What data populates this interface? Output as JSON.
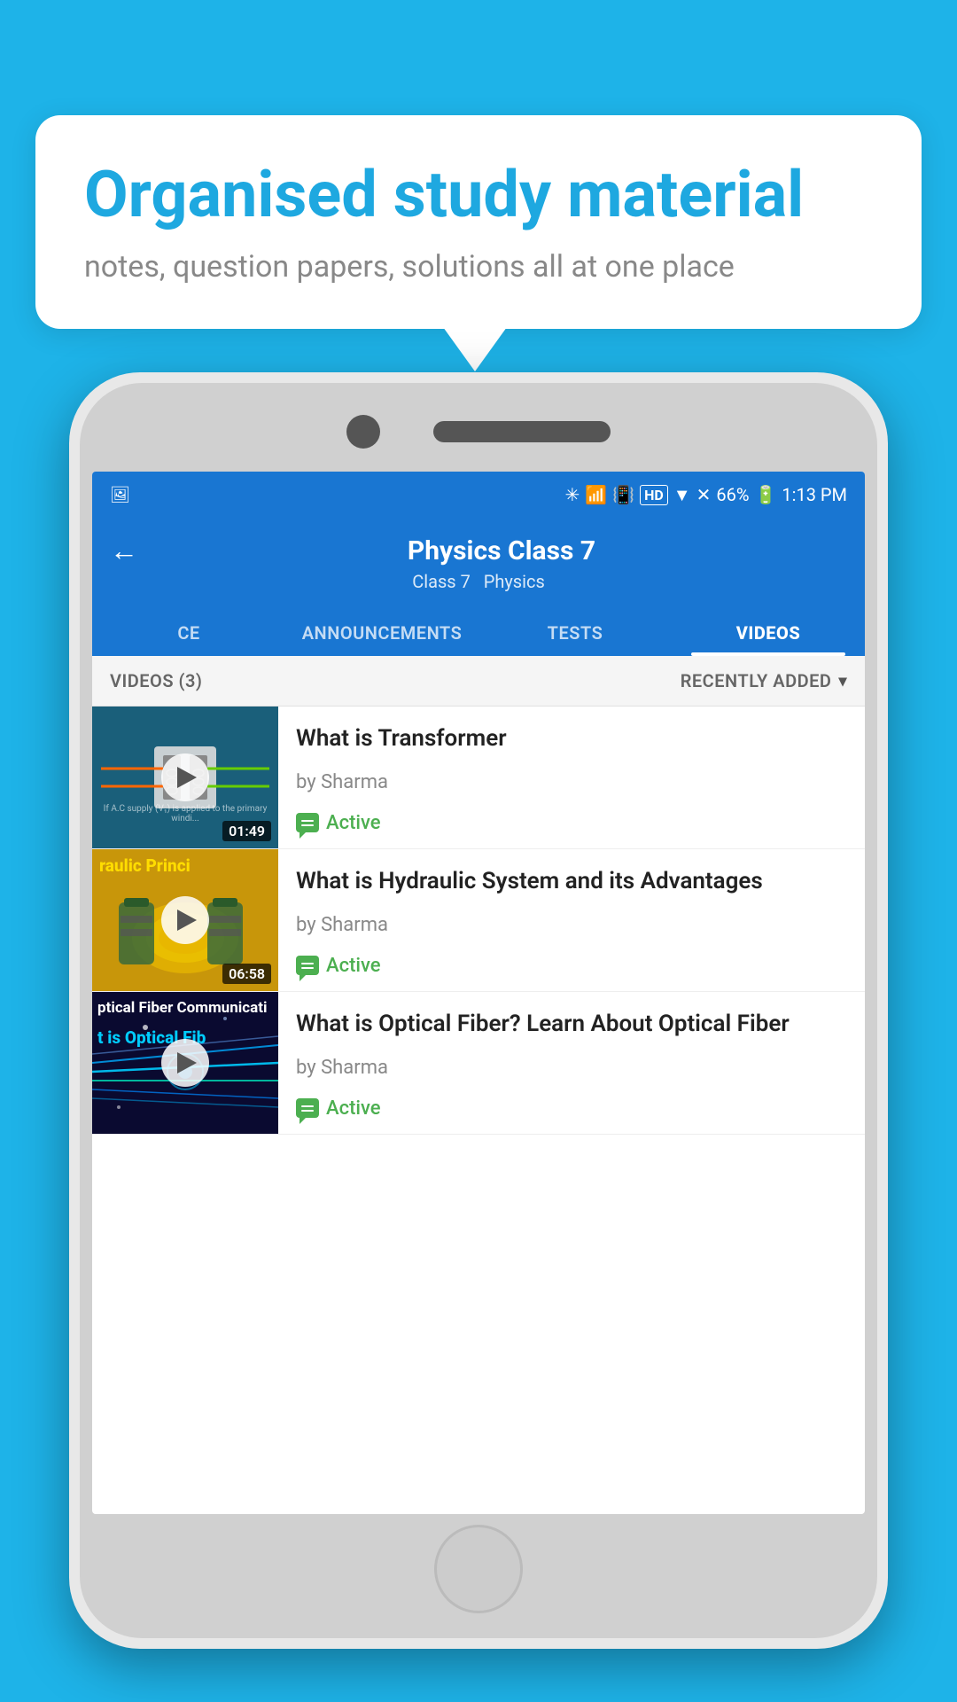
{
  "page": {
    "background_color": "#1eb3e8"
  },
  "bubble": {
    "title": "Organised study material",
    "subtitle": "notes, question papers, solutions all at one place"
  },
  "status_bar": {
    "battery": "66%",
    "time": "1:13 PM",
    "network": "HD"
  },
  "app_bar": {
    "title": "Physics Class 7",
    "subtitle_part1": "Class 7",
    "subtitle_separator": "  ",
    "subtitle_part2": "Physics",
    "back_label": "←"
  },
  "tabs": [
    {
      "id": "ce",
      "label": "CE",
      "active": false
    },
    {
      "id": "announcements",
      "label": "ANNOUNCEMENTS",
      "active": false
    },
    {
      "id": "tests",
      "label": "TESTS",
      "active": false
    },
    {
      "id": "videos",
      "label": "VIDEOS",
      "active": true
    }
  ],
  "videos_header": {
    "count_label": "VIDEOS (3)",
    "sort_label": "RECENTLY ADDED",
    "sort_icon": "▾"
  },
  "videos": [
    {
      "id": 1,
      "title": "What is  Transformer",
      "author": "by Sharma",
      "status": "Active",
      "duration": "01:49",
      "thumb_style": "transformer",
      "thumb_text": "If A.C supply (V₁) is applied to the primary windi..."
    },
    {
      "id": 2,
      "title": "What is Hydraulic System and its Advantages",
      "author": "by Sharma",
      "status": "Active",
      "duration": "06:58",
      "thumb_style": "hydraulic",
      "thumb_label": "raulic Princi"
    },
    {
      "id": 3,
      "title": "What is Optical Fiber? Learn About Optical Fiber",
      "author": "by Sharma",
      "status": "Active",
      "duration": "",
      "thumb_style": "optical",
      "thumb_label_top": "ptical Fiber Communicati",
      "thumb_label_mid": "t is Optical Fib"
    }
  ]
}
